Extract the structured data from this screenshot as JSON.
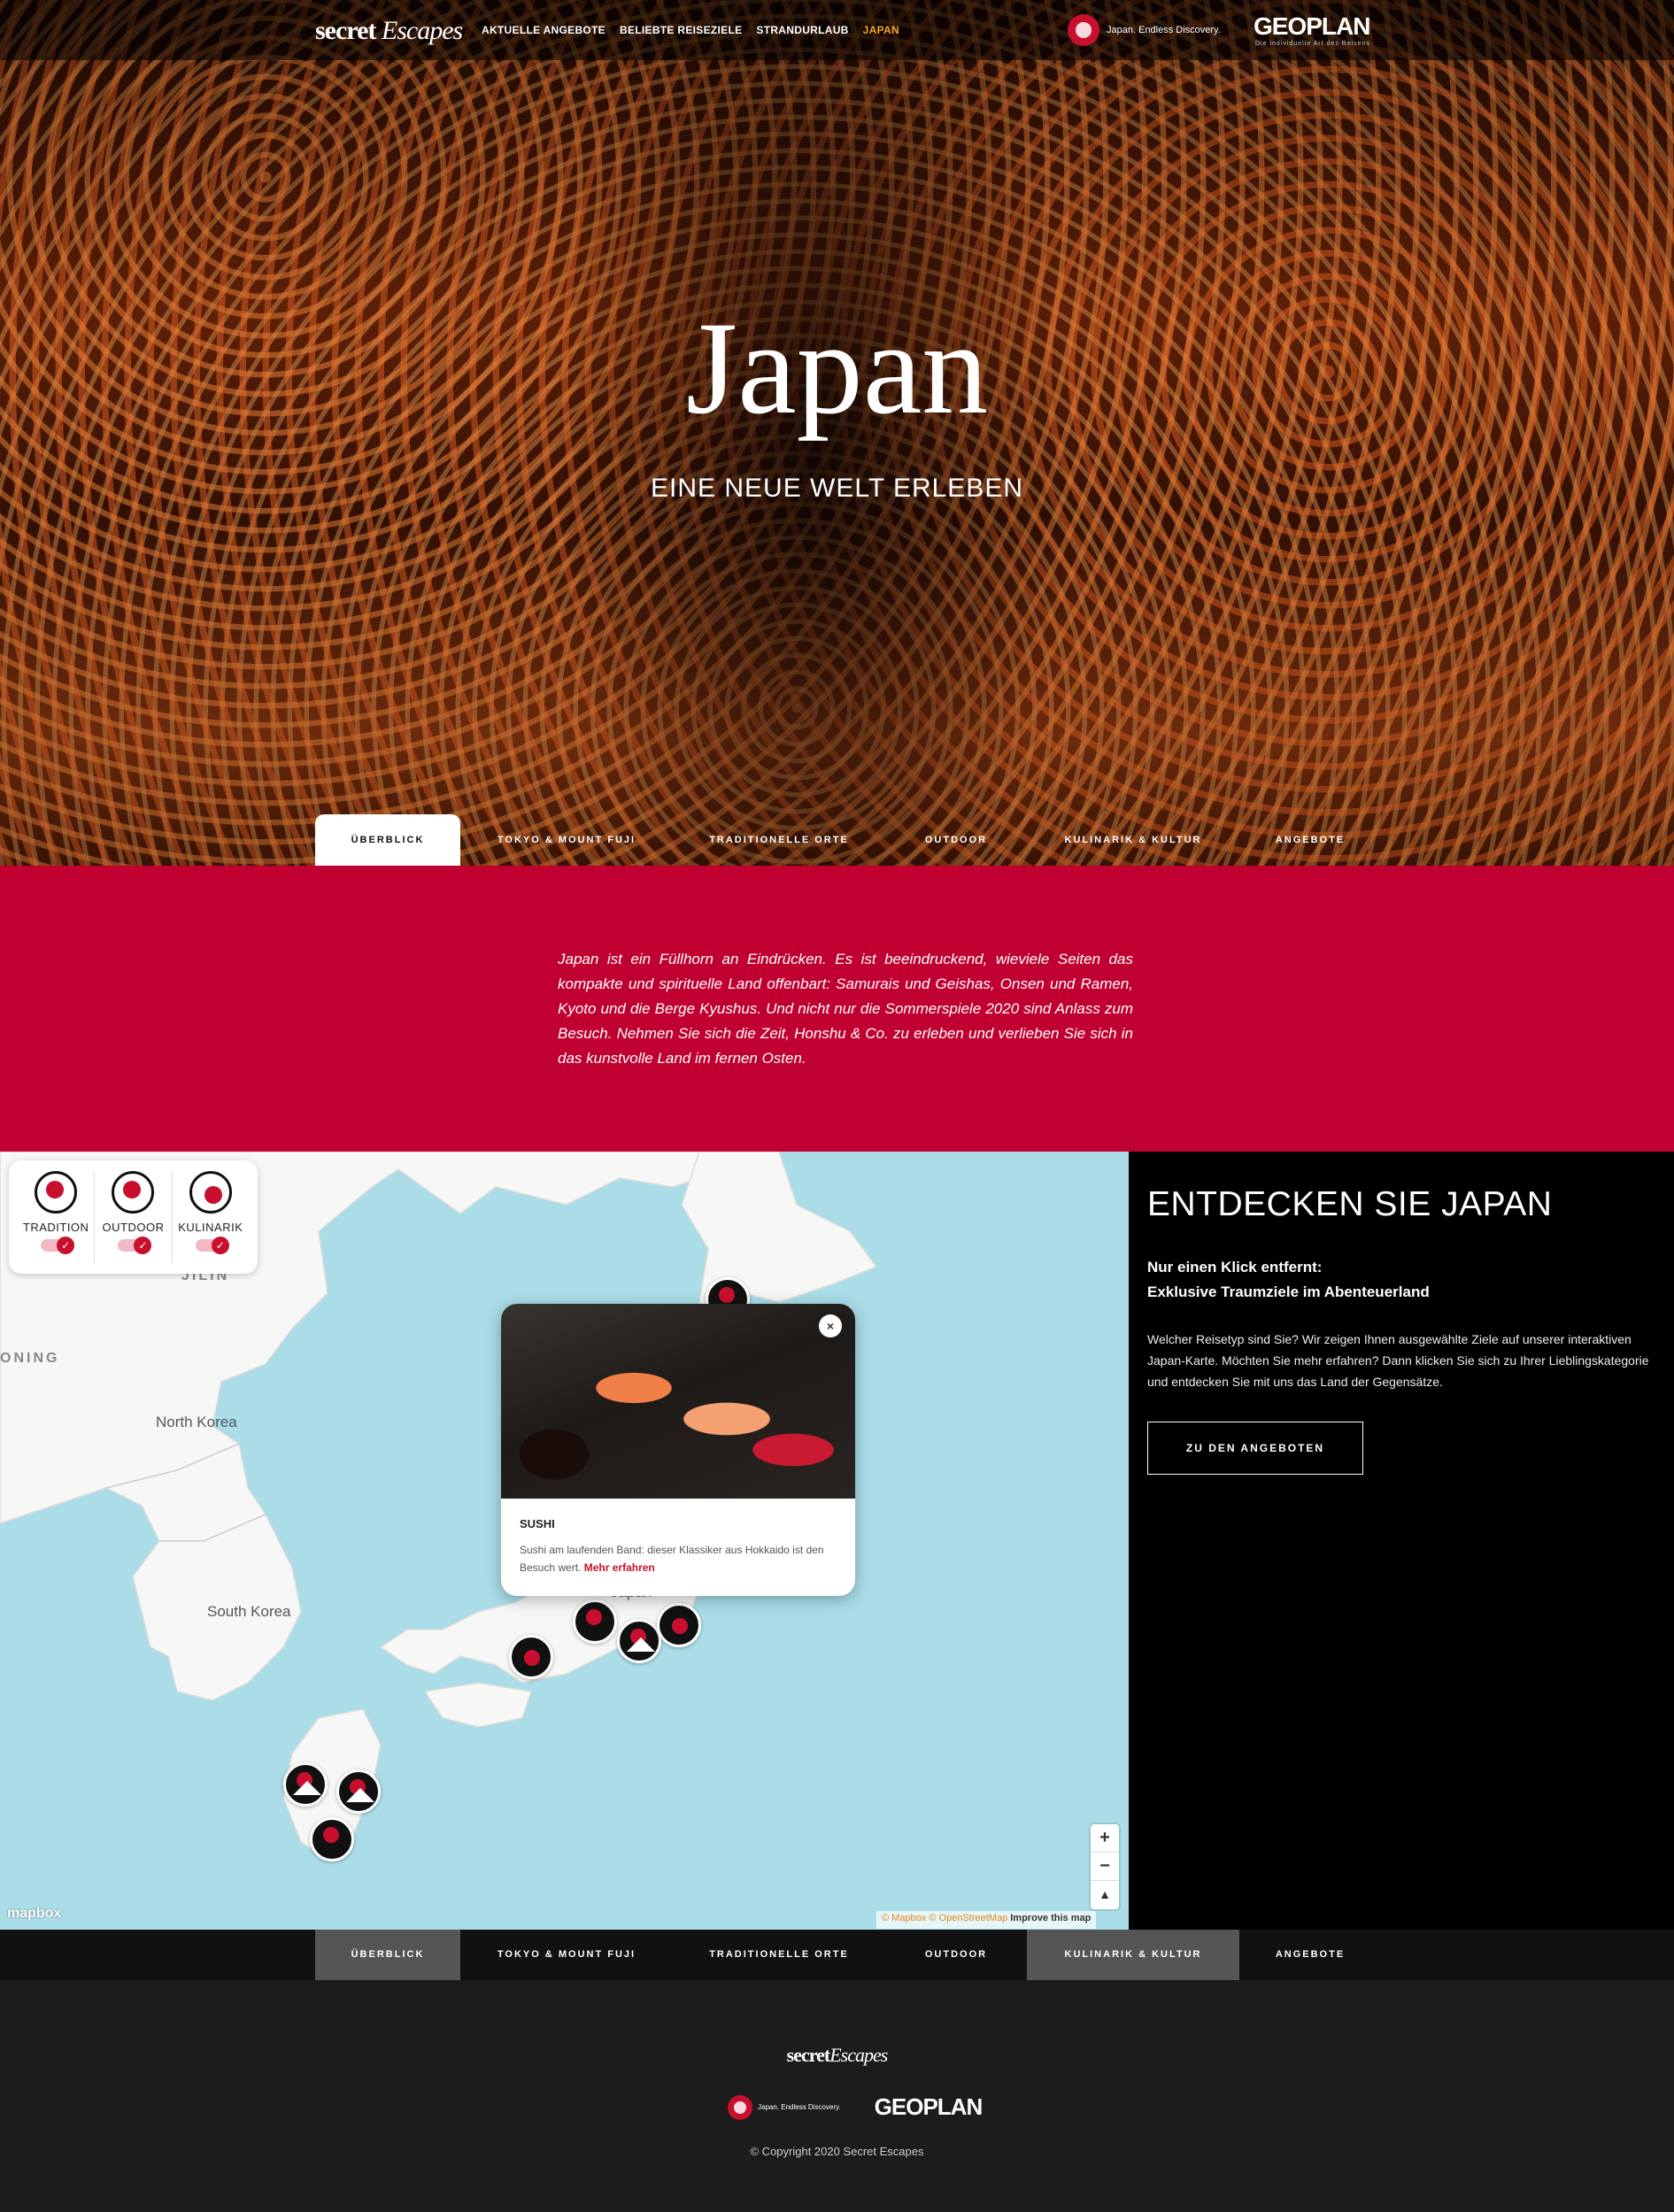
{
  "header": {
    "brand_bold": "secret",
    "brand_light": "Escapes",
    "nav": [
      "AKTUELLE ANGEBOTE",
      "BELIEBTE REISEZIELE",
      "STRANDURLAUB",
      "JAPAN"
    ],
    "partner_logo_text": "Japan. Endless Discovery.",
    "geoplan_logo": "GEOPLAN",
    "geoplan_sub": "Die individuelle Art des Reisens"
  },
  "hero": {
    "title": "Japan",
    "subtitle": "EINE NEUE WELT ERLEBEN"
  },
  "tabs": [
    {
      "label": "ÜBERBLICK",
      "active": true
    },
    {
      "label": "TOKYO & MOUNT FUJI"
    },
    {
      "label": "TRADITIONELLE ORTE"
    },
    {
      "label": "OUTDOOR"
    },
    {
      "label": "KULINARIK & KULTUR"
    },
    {
      "label": "ANGEBOTE"
    }
  ],
  "intro": {
    "text": "Japan ist ein Füllhorn an Eindrücken. Es ist beeindruckend, wieviele Seiten das kompakte und spirituelle Land offenbart: Samurais und Geishas, Onsen und Ramen, Kyoto und die Berge Kyushus. Und nicht nur die Sommerspiele 2020 sind Anlass zum Besuch. Nehmen Sie sich die Zeit, Honshu & Co. zu erleben und verlieben Sie sich in das kunstvolle Land im fernen Osten."
  },
  "map": {
    "filters": [
      "TRADITION",
      "OUTDOOR",
      "KULINARIK"
    ],
    "labels": {
      "jilin": "JILIN",
      "liaoning": "ONING",
      "north_korea": "North Korea",
      "south_korea": "South Korea",
      "japan": "Japan"
    },
    "popup": {
      "title": "SUSHI",
      "text": "Sushi am laufenden Band: dieser Klassiker aus Hokkaido ist den Besuch wert.",
      "link": "Mehr erfahren",
      "close": "×"
    },
    "zoom_in": "+",
    "zoom_out": "−",
    "compass": "▲",
    "mapbox_logo": "mapbox",
    "attribution_mapbox": "© Mapbox",
    "attribution_osm": "© OpenStreetMap",
    "attribution_improve": "Improve this map"
  },
  "discover": {
    "title": "ENTDECKEN SIE JAPAN",
    "subtitle_line1": "Nur einen Klick entfernt:",
    "subtitle_line2": "Exklusive Traumziele im Abenteuerland",
    "text": "Welcher Reisetyp sind Sie? Wir zeigen Ihnen ausgewählte Ziele auf unserer interaktiven Japan-Karte. Möchten Sie mehr erfahren? Dann klicken Sie sich zu Ihrer Lieblingskategorie und entdecken Sie mit uns das Land der Gegensätze.",
    "cta": "ZU DEN ANGEBOTEN"
  },
  "bottom_nav": [
    {
      "label": "ÜBERBLICK",
      "active": true
    },
    {
      "label": "TOKYO & MOUNT FUJI"
    },
    {
      "label": "TRADITIONELLE ORTE"
    },
    {
      "label": "OUTDOOR"
    },
    {
      "label": "KULINARIK & KULTUR",
      "active": true
    },
    {
      "label": "ANGEBOTE"
    }
  ],
  "footer": {
    "brand_bold": "secret",
    "brand_light": "Escapes",
    "partner_logo_text": "Japan. Endless Discovery.",
    "geoplan_logo": "GEOPLAN",
    "copyright": "© Copyright 2020 Secret Escapes"
  },
  "colors": {
    "accent_red": "#bf0030",
    "nav_active": "#f5a623",
    "map_water": "#aadde8",
    "dark_panel": "#000000",
    "footer_bg": "#1c1c1c"
  }
}
